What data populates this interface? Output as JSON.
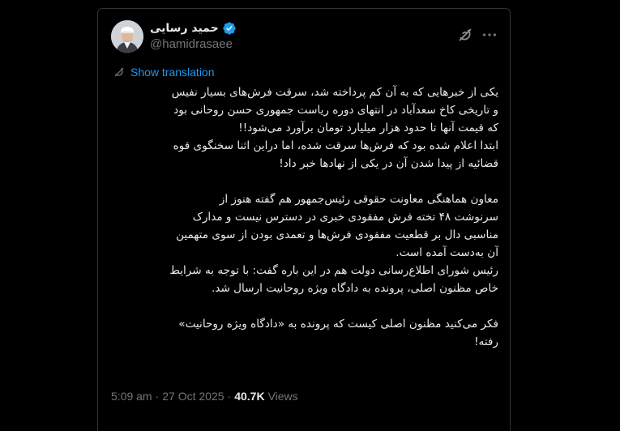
{
  "tweet": {
    "display_name": "حمید رسایی",
    "handle": "@hamidrasaee",
    "translate_label": "Show translation",
    "paragraph_1": [
      "یکی از خبرهایی که به آن کم پرداخته شد، سرقت فرش‌های بسیار نفیس",
      "و تاریخی کاخ سعدآباد در انتهای دوره ریاست جمهوری حسن روحانی بود",
      "که قیمت آنها تا حدود هزار میلیارد تومان برآورد می‌شود!!",
      "ابتدا اعلام شده بود که فرش‌ها سرقت شده، اما دراین اثنا سخنگوی قوه",
      "قضائیه از پیدا شدن آن در یکی از نهادها خبر داد!"
    ],
    "paragraph_2": [
      "معاون هماهنگی معاونت حقوقی رئیس‌جمهور هم گفته هنوز از",
      "سرنوشت ۴۸ تخته فرش مفقودی خبری در دسترس نیست و مدارک",
      "مناسبی دال بر قطعیت مفقودی فرش‌ها و تعمدی بودن از سوی متهمین",
      "آن به‌دست آمده است.",
      "رئیس شورای اطلاع‌رسانی دولت هم در این باره گفت: با توجه به شرایط",
      "خاص مظنون اصلی، پرونده به دادگاه ویژه روحانیت ارسال شد."
    ],
    "paragraph_3": [
      "فکر می‌کنید مظنون اصلی کیست که پرونده به «دادگاه ویژه روحانیت»",
      "رفته!"
    ],
    "time": "5:09 am",
    "separator": "·",
    "date": "27 Oct 2025",
    "views_count": "40.7K",
    "views_label": "Views"
  },
  "icons": {
    "verified": "verified-badge-icon",
    "grok": "grok-icon",
    "more": "more-icon",
    "translate": "translate-icon"
  },
  "colors": {
    "background": "#000000",
    "text": "#e7e9ea",
    "muted": "#71767b",
    "link": "#1d9bf0",
    "border": "#2f3336"
  }
}
